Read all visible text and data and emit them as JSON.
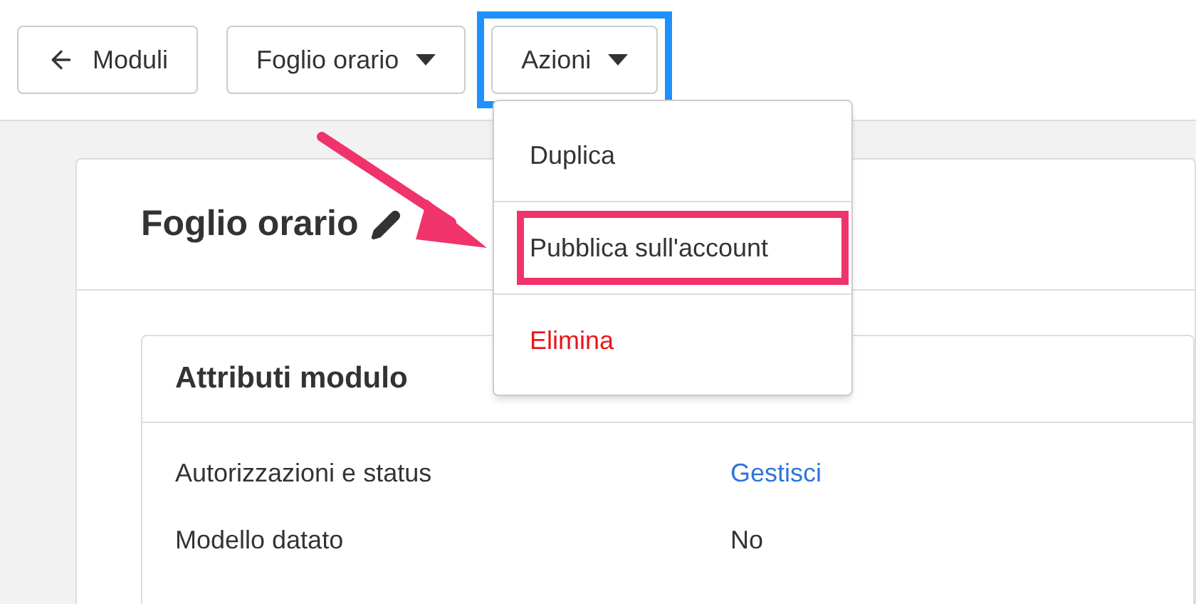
{
  "toolbar": [
    {
      "label": "Moduli",
      "kind": "back",
      "highlighted": false
    },
    {
      "label": "Foglio orario",
      "kind": "dropdown",
      "highlighted": false
    },
    {
      "label": "Azioni",
      "kind": "dropdown",
      "highlighted": true
    }
  ],
  "menu": {
    "items": [
      {
        "label": "Duplica",
        "kind": "normal",
        "highlighted": false
      },
      {
        "label": "Pubblica sull'account",
        "kind": "normal",
        "highlighted": true
      },
      {
        "label": "Elimina",
        "kind": "danger",
        "highlighted": false
      }
    ]
  },
  "page": {
    "title": "Foglio orario",
    "section": {
      "title": "Attributi modulo",
      "rows": [
        {
          "label": "Autorizzazioni e status",
          "value": "Gestisci",
          "kind": "link"
        },
        {
          "label": "Modello datato",
          "value": "No",
          "kind": "text"
        }
      ]
    }
  }
}
